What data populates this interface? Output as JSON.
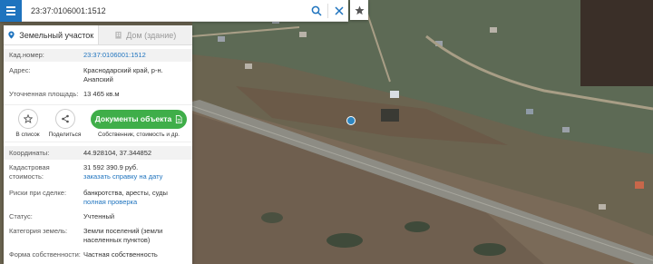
{
  "search": {
    "value": "23:37:0106001:1512"
  },
  "icons": {
    "menu": "menu-icon",
    "search": "search-icon",
    "close": "close-icon",
    "star": "star-icon",
    "parcel": "parcel-icon",
    "building": "building-icon",
    "list": "star-outline-icon",
    "share": "share-icon",
    "document": "document-icon"
  },
  "tabs": [
    {
      "label": "Земельный участок"
    },
    {
      "label": "Дом (здание)"
    }
  ],
  "info": {
    "cadnum_label": "Кад.номер:",
    "cadnum_value": "23:37:0106001:1512",
    "address_label": "Адрес:",
    "address_value": "Краснодарский край, р-н. Анапский",
    "area_label": "Уточненная площадь:",
    "area_value": "13 465 кв.м"
  },
  "actions": {
    "list_label": "В список",
    "share_label": "Поделиться",
    "docs_label": "Документы объекта",
    "docs_caption": "Собственник, стоимость и др."
  },
  "details": {
    "coords_label": "Координаты:",
    "coords_value": "44.928104, 37.344852",
    "cost_label": "Кадастровая стоимость:",
    "cost_value": "31 592 390.9 руб.",
    "cost_link": "заказать справку на дату",
    "risk_label": "Риски при сделке:",
    "risk_value": "банкротства, аресты, суды",
    "risk_link": "полная проверка",
    "status_label": "Статус:",
    "status_value": "Учтенный",
    "category_label": "Категория земель:",
    "category_value": "Земли поселений (земли населенных пунктов)",
    "ownership_label": "Форма собственности:",
    "ownership_value": "Частная собственность"
  },
  "colors": {
    "accent": "#1e73be",
    "docs_button": "#3fae49",
    "pin": "#2e86c1"
  }
}
